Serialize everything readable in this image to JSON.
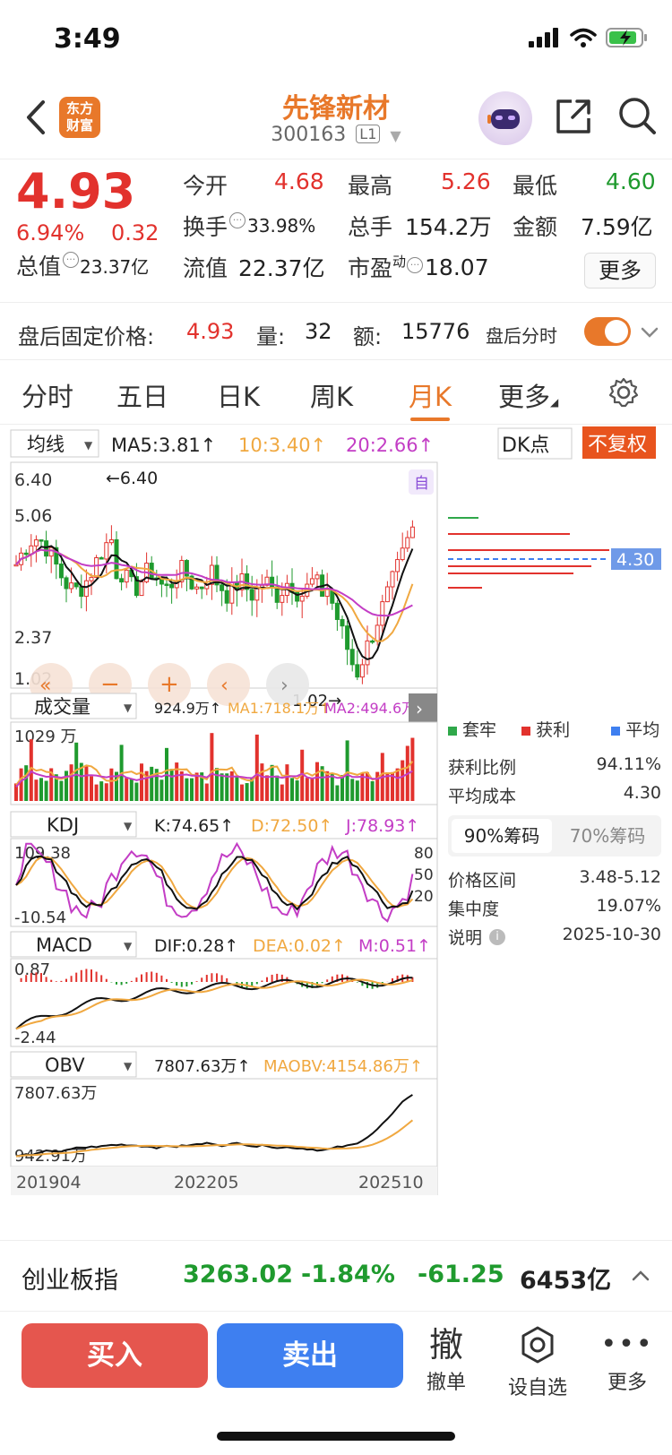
{
  "status_bar": {
    "time": "3:49"
  },
  "header": {
    "logo_line1": "东方",
    "logo_line2": "财富",
    "stock_name": "先锋新材",
    "stock_code": "300163",
    "level_badge": "L1"
  },
  "quote": {
    "price": "4.93",
    "change_pct": "6.94%",
    "change_val": "0.32",
    "total_cap_label": "总值",
    "total_cap": "23.37亿",
    "open_label": "今开",
    "open": "4.68",
    "turnover_label": "换手",
    "turnover": "33.98%",
    "float_cap_label": "流值",
    "float_cap": "22.37亿",
    "high_label": "最高",
    "high": "5.26",
    "total_vol_label": "总手",
    "total_vol": "154.2万",
    "pe_label": "市盈",
    "pe_sup": "动",
    "pe": "18.07",
    "low_label": "最低",
    "low": "4.60",
    "amount_label": "金额",
    "amount": "7.59亿",
    "more_label": "更多"
  },
  "afterhours": {
    "price_label": "盘后固定价格:",
    "price": "4.93",
    "vol_label": "量:",
    "vol": "32",
    "amount_label": "额:",
    "amount": "15776",
    "toggle_label": "盘后分时"
  },
  "tabs": [
    "分时",
    "五日",
    "日K",
    "周K",
    "月K",
    "更多"
  ],
  "chart": {
    "ma_selector": "均线",
    "ma5": "MA5:3.81↑",
    "ma10": "10:3.40↑",
    "ma20": "20:2.66↑",
    "dk_label": "DK点",
    "adjust_label": "不复权",
    "y_labels": [
      "6.40",
      "5.06",
      "2.37",
      "1.02"
    ],
    "high_marker": "←6.40",
    "low_marker": "1.02→",
    "auto_badge": "自",
    "vol_selector": "成交量",
    "vol_val": "924.9万↑",
    "vol_ma1": "MA1:718.1万↑",
    "vol_ma2": "MA2:494.6万↑",
    "vol_max": "1029 万",
    "kdj_selector": "KDJ",
    "kdj_k": "K:74.65↑",
    "kdj_d": "D:72.50↑",
    "kdj_j": "J:78.93↑",
    "kdj_top": "109.38",
    "kdj_bottom": "-10.54",
    "kdj_80": "80",
    "kdj_50": "50",
    "kdj_20": "20",
    "macd_selector": "MACD",
    "macd_dif": "DIF:0.28↑",
    "macd_dea": "DEA:0.02↑",
    "macd_m": "M:0.51↑",
    "macd_top": "0.87",
    "macd_bottom": "-2.44",
    "obv_selector": "OBV",
    "obv_val": "7807.63万↑",
    "obv_ma": "MAOBV:4154.86万↑",
    "obv_top": "7807.63万",
    "obv_bottom": "942.91万",
    "dates": [
      "201904",
      "202205",
      "202510"
    ],
    "chip_price": "4.30"
  },
  "chips": {
    "legend_trapped": "套牢",
    "legend_profit": "获利",
    "legend_avg": "平均",
    "profit_ratio_label": "获利比例",
    "profit_ratio": "94.11%",
    "avg_cost_label": "平均成本",
    "avg_cost": "4.30",
    "tab90": "90%筹码",
    "tab70": "70%筹码",
    "range_label": "价格区间",
    "range": "3.48-5.12",
    "concentration_label": "集中度",
    "concentration": "19.07%",
    "note_label": "说明",
    "note_date": "2025-10-30"
  },
  "index_bar": {
    "name": "创业板指",
    "value": "3263.02",
    "pct": "-1.84%",
    "change": "-61.25",
    "amount": "6453亿"
  },
  "actions": {
    "buy": "买入",
    "sell": "卖出",
    "cancel_glyph": "撤",
    "cancel_label": "撤单",
    "watch_label": "设自选",
    "more_label": "更多"
  },
  "colors": {
    "up": "#e2322d",
    "down": "#1f9a2e",
    "accent": "#e8782a",
    "blue": "#3e7ff0"
  }
}
